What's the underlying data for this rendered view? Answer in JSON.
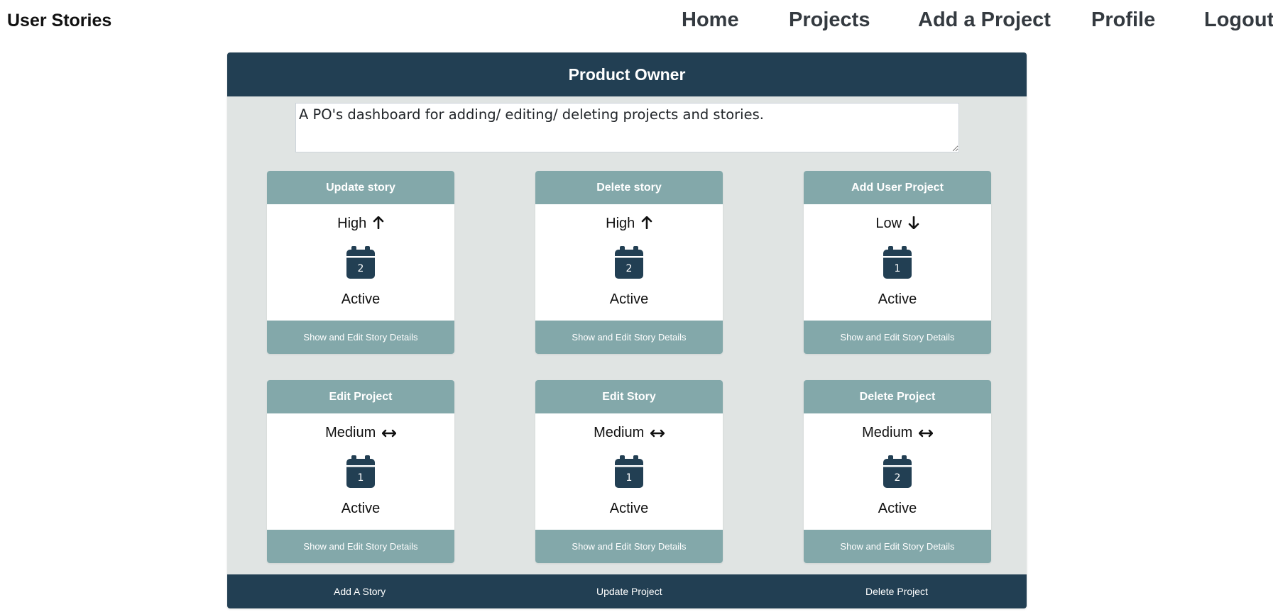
{
  "navbar": {
    "brand": "User Stories",
    "links": [
      "Home",
      "Projects",
      "Add a Project",
      "Profile",
      "Logout"
    ]
  },
  "panel": {
    "title": "Product Owner",
    "description": "A PO's dashboard for adding/ editing/ deleting projects and stories."
  },
  "cards": [
    {
      "title": "Update story",
      "priority": "High",
      "priority_icon": "arrow-up-icon",
      "days": "2",
      "status": "Active",
      "action": "Show and Edit Story Details"
    },
    {
      "title": "Delete story",
      "priority": "High",
      "priority_icon": "arrow-up-icon",
      "days": "2",
      "status": "Active",
      "action": "Show and Edit Story Details"
    },
    {
      "title": "Add User Project",
      "priority": "Low",
      "priority_icon": "arrow-down-icon",
      "days": "1",
      "status": "Active",
      "action": "Show and Edit Story Details"
    },
    {
      "title": "Edit Project",
      "priority": "Medium",
      "priority_icon": "arrows-horizontal-icon",
      "days": "1",
      "status": "Active",
      "action": "Show and Edit Story Details"
    },
    {
      "title": "Edit Story",
      "priority": "Medium",
      "priority_icon": "arrows-horizontal-icon",
      "days": "1",
      "status": "Active",
      "action": "Show and Edit Story Details"
    },
    {
      "title": "Delete Project",
      "priority": "Medium",
      "priority_icon": "arrows-horizontal-icon",
      "days": "2",
      "status": "Active",
      "action": "Show and Edit Story Details"
    }
  ],
  "footer": {
    "links": [
      "Add A Story",
      "Update Project",
      "Delete Project"
    ]
  },
  "colors": {
    "primary_dark": "#223f53",
    "card_accent": "#83a8aa",
    "panel_bg": "#e0e4e3"
  }
}
